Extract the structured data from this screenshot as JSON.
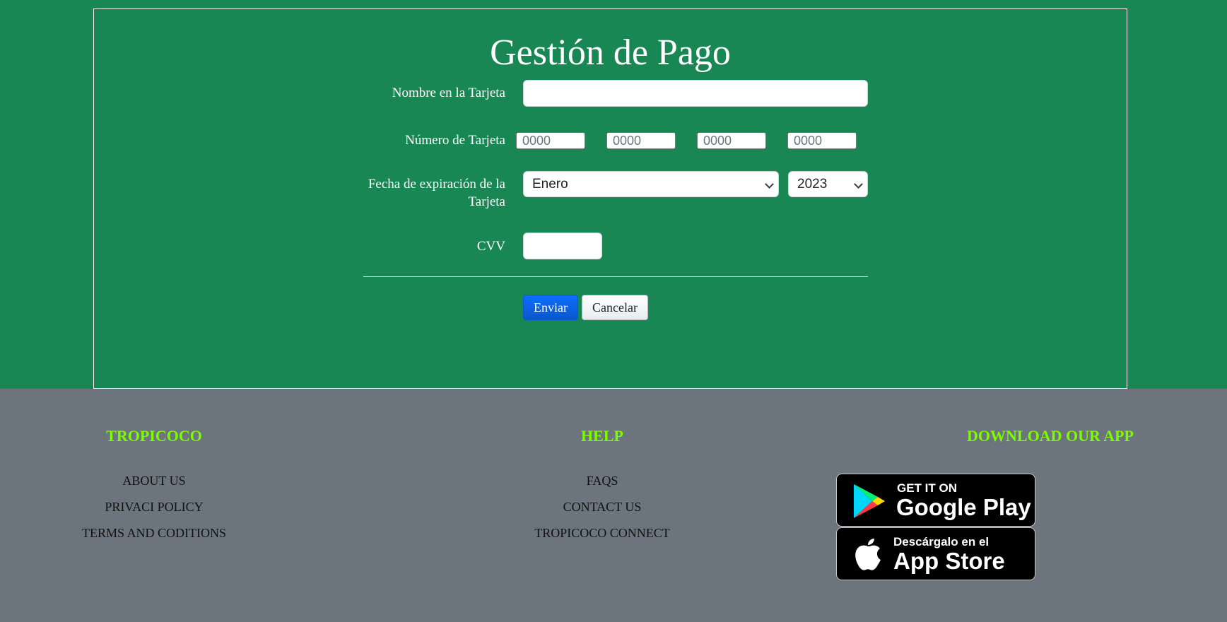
{
  "form": {
    "title": "Gestión de Pago",
    "name_label": "Nombre en la Tarjeta",
    "name_value": "",
    "card_number_label": "Número de Tarjeta",
    "card_groups": [
      {
        "placeholder": "0000"
      },
      {
        "placeholder": "0000"
      },
      {
        "placeholder": "0000"
      },
      {
        "placeholder": "0000"
      }
    ],
    "expiry_label_line1": "Fecha de expiración de la",
    "expiry_label_line2": "Tarjeta",
    "expiry_month": "Enero",
    "expiry_year": "2023",
    "cvv_label": "CVV",
    "cvv_value": "",
    "submit_label": "Enviar",
    "cancel_label": "Cancelar"
  },
  "footer": {
    "col1": {
      "heading": "TROPICOCO",
      "links": [
        "ABOUT US",
        "PRIVACI POLICY",
        "TERMS AND CODITIONS"
      ]
    },
    "col2": {
      "heading": "HELP",
      "links": [
        "FAQS",
        "CONTACT US",
        "TROPICOCO CONNECT"
      ]
    },
    "col3": {
      "heading": "DOWNLOAD OUR APP",
      "google_play": {
        "small": "GET IT ON",
        "big": "Google Play"
      },
      "app_store": {
        "small": "Descárgalo en el",
        "big": "App Store"
      }
    }
  },
  "colors": {
    "form_bg": "#198754",
    "footer_bg": "#6c757d",
    "footer_heading": "#7cfc00",
    "primary_button": "#0d6efd"
  }
}
